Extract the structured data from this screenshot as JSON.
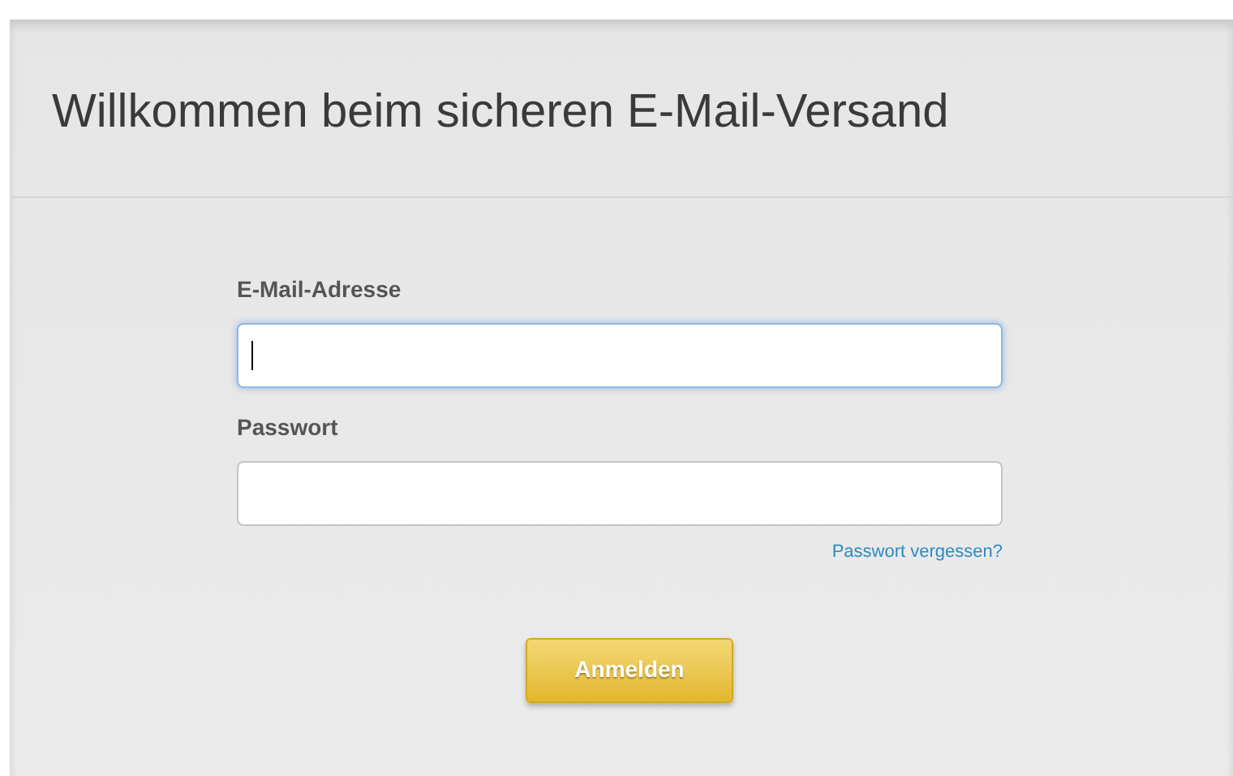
{
  "title": "Willkommen beim sicheren E-Mail-Versand",
  "fields": [
    {
      "label": "E-Mail-Adresse",
      "focused": true
    },
    {
      "label": "Passwort",
      "focused": false
    }
  ],
  "forgot_link": "Passwort vergessen?",
  "submit_button": "Anmelden"
}
